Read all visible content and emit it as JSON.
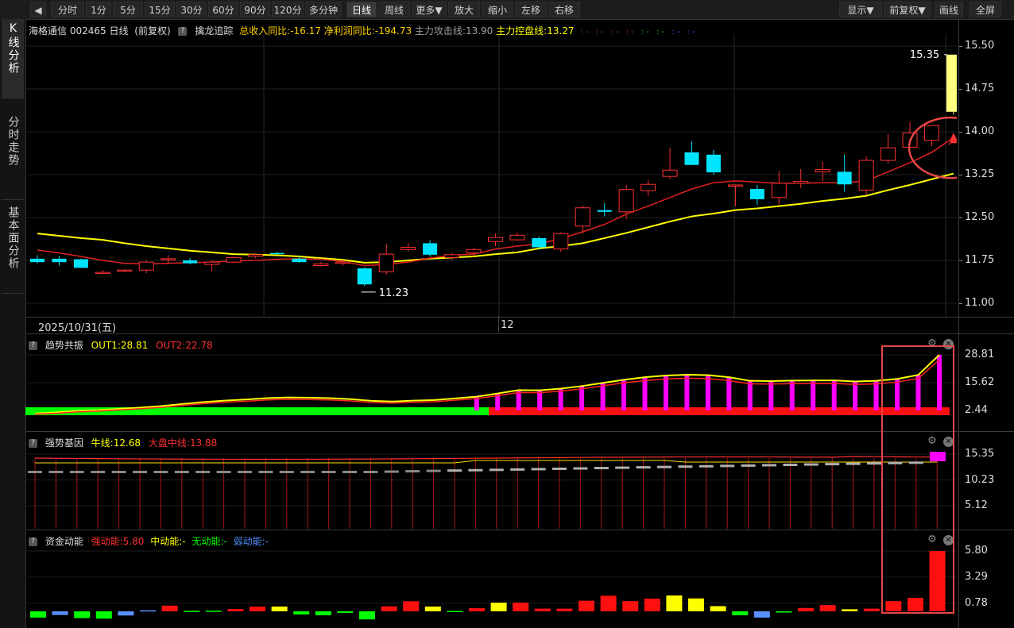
{
  "toolbar": {
    "periods": [
      "分时",
      "1分",
      "5分",
      "15分",
      "30分",
      "60分",
      "90分",
      "120分",
      "多分钟",
      "日线",
      "周线",
      "更多▼",
      "放大",
      "缩小",
      "左移",
      "右移"
    ],
    "active": "日线",
    "right_buttons": [
      "显示▼",
      "前复权▼",
      "画线",
      "全屏"
    ]
  },
  "sidebar": {
    "tabs": [
      "K线分析",
      "分时走势",
      "基本面分析"
    ],
    "active": "K线分析"
  },
  "main_pane": {
    "stock_label": "海格通信 002465 日线",
    "adjust_label": "(前复权)",
    "indicator_name": "擒龙追踪",
    "items": [
      {
        "text": "总收入同比:-16.17",
        "color": "#ffd000"
      },
      {
        "text": "净利润同比:-194.73",
        "color": "#ffd000"
      },
      {
        "text": "主力攻击线:13.90",
        "color": "#a0a0a0"
      },
      {
        "text": "主力控盘线:13.27",
        "color": "#ffff00"
      }
    ],
    "y_ticks": [
      "15.50",
      "14.75",
      "14.00",
      "13.25",
      "12.50",
      "11.75",
      "11.00"
    ],
    "high_label": "15.35",
    "low_label": "11.23",
    "date_label": "2025/10/31(五)",
    "month_label": "12"
  },
  "pane_trend": {
    "name": "趋势共振",
    "out1": "OUT1:28.81",
    "out2": "OUT2:22.78",
    "y_ticks": [
      "28.81",
      "15.62",
      "2.44"
    ]
  },
  "pane_gene": {
    "name": "强势基因",
    "niu": "牛线:12.68",
    "dapan": "大盘中线:13.88",
    "y_ticks": [
      "15.35",
      "10.23",
      "5.12"
    ]
  },
  "pane_fund": {
    "name": "资金动能",
    "strong": "强动能:5.80",
    "mid": "中动能:-",
    "none": "无动能:-",
    "weak": "弱动能:-",
    "y_ticks": [
      "5.80",
      "3.29",
      "0.78"
    ]
  },
  "colors": {
    "up": "#ff3030",
    "down": "#00e5ff",
    "ma_yellow": "#ffff00",
    "ma_red": "#e02020",
    "magenta": "#ff00ff",
    "green": "#00ff00"
  },
  "chart_data": {
    "type": "candlestick",
    "ohlc": [
      [
        11.78,
        11.84,
        11.7,
        11.72
      ],
      [
        11.78,
        11.83,
        11.66,
        11.72
      ],
      [
        11.77,
        11.78,
        11.62,
        11.62
      ],
      [
        11.54,
        11.58,
        11.51,
        11.54
      ],
      [
        11.57,
        11.6,
        11.55,
        11.58
      ],
      [
        11.58,
        11.75,
        11.53,
        11.72
      ],
      [
        11.76,
        11.84,
        11.7,
        11.78
      ],
      [
        11.75,
        11.79,
        11.68,
        11.7
      ],
      [
        11.68,
        11.75,
        11.56,
        11.72
      ],
      [
        11.72,
        11.82,
        11.7,
        11.8
      ],
      [
        11.82,
        11.87,
        11.79,
        11.85
      ],
      [
        11.88,
        11.9,
        11.85,
        11.87
      ],
      [
        11.78,
        11.82,
        11.71,
        11.72
      ],
      [
        11.66,
        11.72,
        11.64,
        11.69
      ],
      [
        11.7,
        11.76,
        11.66,
        11.72
      ],
      [
        11.61,
        11.63,
        11.3,
        11.33
      ],
      [
        11.55,
        12.04,
        11.5,
        11.86
      ],
      [
        11.94,
        12.05,
        11.9,
        11.98
      ],
      [
        12.05,
        12.1,
        11.82,
        11.85
      ],
      [
        11.8,
        11.88,
        11.75,
        11.85
      ],
      [
        11.88,
        11.97,
        11.82,
        11.94
      ],
      [
        12.08,
        12.22,
        12.0,
        12.15
      ],
      [
        12.11,
        12.24,
        12.09,
        12.19
      ],
      [
        12.14,
        12.17,
        11.94,
        11.98
      ],
      [
        11.95,
        12.24,
        11.9,
        12.22
      ],
      [
        12.35,
        12.71,
        12.22,
        12.67
      ],
      [
        12.63,
        12.75,
        12.52,
        12.6
      ],
      [
        12.6,
        13.07,
        12.47,
        12.99
      ],
      [
        12.97,
        13.15,
        12.88,
        13.08
      ],
      [
        13.22,
        13.72,
        13.17,
        13.33
      ],
      [
        13.64,
        13.83,
        13.51,
        13.42
      ],
      [
        13.6,
        13.68,
        13.25,
        13.29
      ],
      [
        13.07,
        13.08,
        12.7,
        13.07
      ],
      [
        13.0,
        13.07,
        12.72,
        12.82
      ],
      [
        12.85,
        13.31,
        12.73,
        13.1
      ],
      [
        13.1,
        13.35,
        13.02,
        13.13
      ],
      [
        13.3,
        13.48,
        13.14,
        13.34
      ],
      [
        13.3,
        13.6,
        12.95,
        13.08
      ],
      [
        12.98,
        13.57,
        12.9,
        13.5
      ],
      [
        13.5,
        13.96,
        13.44,
        13.72
      ],
      [
        13.73,
        14.17,
        13.68,
        13.98
      ],
      [
        13.85,
        14.11,
        13.75,
        14.11
      ],
      [
        14.35,
        15.35,
        14.3,
        15.35
      ]
    ],
    "ma_yellow": [
      12.22,
      12.18,
      12.14,
      12.11,
      12.05,
      12.0,
      11.96,
      11.92,
      11.89,
      11.86,
      11.85,
      11.84,
      11.82,
      11.79,
      11.76,
      11.71,
      11.72,
      11.75,
      11.78,
      11.8,
      11.82,
      11.86,
      11.89,
      11.96,
      12.0,
      12.05,
      12.14,
      12.23,
      12.33,
      12.43,
      12.52,
      12.57,
      12.63,
      12.66,
      12.7,
      12.74,
      12.79,
      12.83,
      12.88,
      12.98,
      13.07,
      13.17,
      13.27
    ],
    "ma_red": [
      11.93,
      11.88,
      11.82,
      11.75,
      11.7,
      11.69,
      11.7,
      11.71,
      11.72,
      11.74,
      11.75,
      11.77,
      11.78,
      11.77,
      11.73,
      11.66,
      11.68,
      11.72,
      11.79,
      11.84,
      11.86,
      11.95,
      12.0,
      12.04,
      12.13,
      12.25,
      12.38,
      12.56,
      12.7,
      12.85,
      13.0,
      13.11,
      13.14,
      13.12,
      13.1,
      13.1,
      13.11,
      13.11,
      13.14,
      13.3,
      13.46,
      13.64,
      13.9
    ],
    "trend_bars": [
      1.0,
      1.5,
      2.2,
      2.6,
      3.2,
      3.8,
      4.5,
      5.5,
      6.4,
      7.1,
      7.6,
      8.3,
      8.6,
      8.5,
      8.3,
      7.8,
      7.0,
      6.7,
      7.1,
      7.4,
      8.2,
      9.0,
      10.5,
      12.1,
      12.0,
      12.8,
      14.0,
      15.5,
      17.0,
      18.2,
      19.0,
      19.4,
      19.2,
      18.2,
      16.5,
      16.4,
      16.6,
      16.7,
      16.7,
      16.2,
      16.5,
      17.4,
      19.3,
      28.81
    ],
    "fund_bars": [
      -0.6,
      -0.35,
      -0.65,
      -0.7,
      -0.4,
      0.1,
      0.55,
      0.05,
      0.06,
      0.22,
      0.45,
      0.46,
      -0.3,
      -0.38,
      -0.15,
      -0.78,
      0.48,
      0.97,
      0.46,
      0.04,
      0.3,
      0.83,
      0.84,
      0.26,
      0.26,
      1.02,
      1.5,
      0.98,
      1.22,
      1.52,
      1.24,
      0.5,
      -0.38,
      -0.6,
      -0.12,
      0.32,
      0.6,
      0.2,
      0.26,
      0.98,
      1.3,
      5.8
    ]
  }
}
